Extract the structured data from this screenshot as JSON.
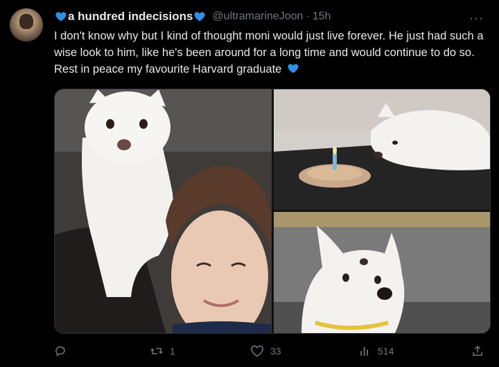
{
  "tweet": {
    "display_name": "a hundred indecisions",
    "handle": "@ultramarineJoon",
    "separator": "·",
    "time": "15h",
    "more_icon": "more-horizontal-icon",
    "text": "I don't know why but I kind of thought moni would just live forever. He just had such a wise look to him, like he's been around for a long time and would continue to do so. Rest in peace my favourite Harvard graduate",
    "heart_color": "#2f8fe6",
    "more_label": "···"
  },
  "media": {
    "images": [
      {
        "name": "white-dog-with-man-selfie"
      },
      {
        "name": "white-dog-with-birthday-candle"
      },
      {
        "name": "white-dog-closeup-outdoors"
      }
    ]
  },
  "actions": {
    "reply": {
      "icon": "reply-icon",
      "count": ""
    },
    "retweet": {
      "icon": "retweet-icon",
      "count": "1"
    },
    "like": {
      "icon": "heart-icon",
      "count": "33"
    },
    "views": {
      "icon": "views-icon",
      "count": "514"
    },
    "share": {
      "icon": "share-icon",
      "count": ""
    }
  }
}
